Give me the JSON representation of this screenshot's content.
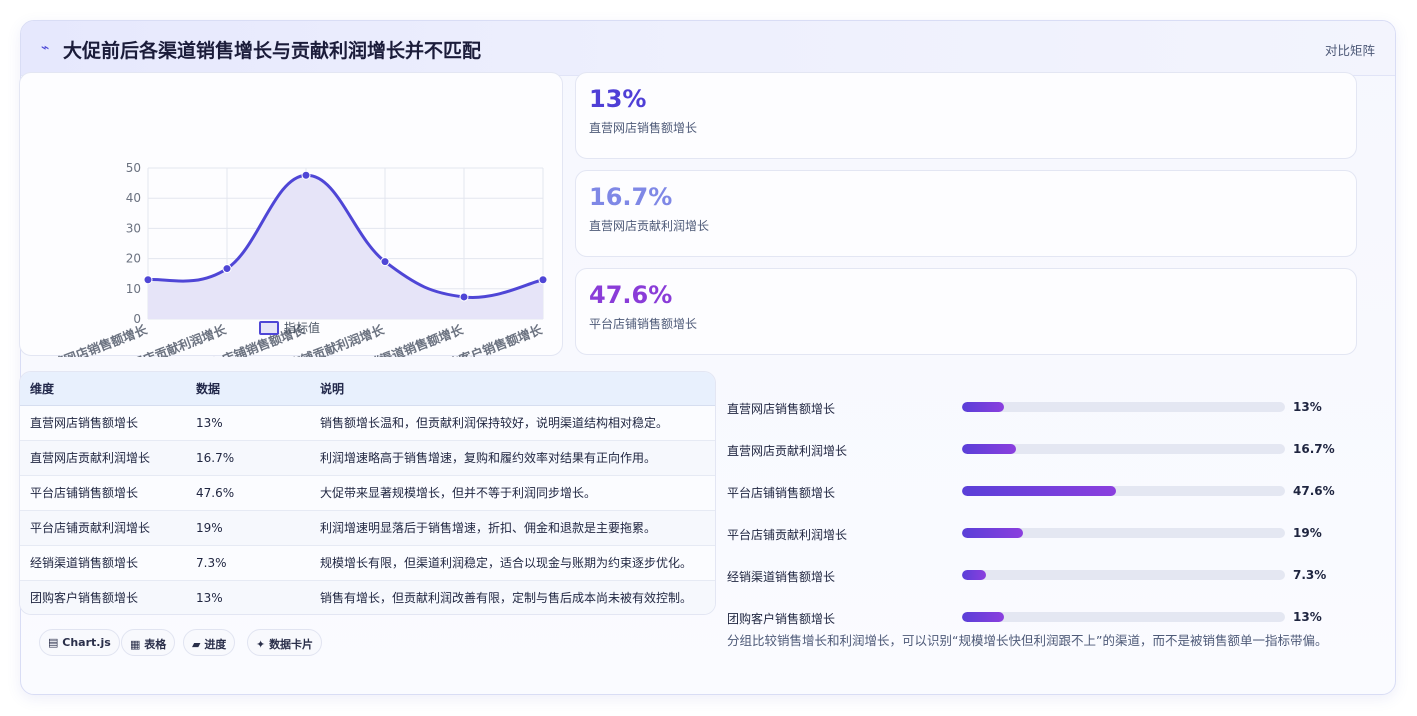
{
  "header": {
    "icon": "trend-icon",
    "title": "大促前后各渠道销售增长与贡献利润增长并不匹配",
    "badge": "对比矩阵"
  },
  "chart_data": {
    "type": "line",
    "categories": [
      "直营网店销售额增长",
      "直营网店贡献利润增长",
      "平台店铺销售额增长",
      "平台店铺贡献利润增长",
      "经销渠道销售额增长",
      "团购客户销售额增长"
    ],
    "series": [
      {
        "name": "指标值",
        "values": [
          13,
          16.7,
          47.6,
          19,
          7.3,
          13
        ]
      }
    ],
    "ylim": [
      0,
      50
    ],
    "yticks": [
      0,
      10,
      20,
      30,
      40,
      50
    ],
    "grid": true,
    "legend": "bottom",
    "smooth": true,
    "filled": true,
    "colors": {
      "line": "#4f46d6",
      "fill": "#e6e4f8"
    }
  },
  "kpis": [
    {
      "value": "13%",
      "label": "直营网店销售额增长",
      "color": "#4f3fd6"
    },
    {
      "value": "16.7%",
      "label": "直营网店贡献利润增长",
      "color": "#7f88e6"
    },
    {
      "value": "47.6%",
      "label": "平台店铺销售额增长",
      "color": "#8a3cd8"
    }
  ],
  "table": {
    "headers": [
      "维度",
      "数据",
      "说明"
    ],
    "rows": [
      [
        "直营网店销售额增长",
        "13%",
        "销售额增长温和，但贡献利润保持较好，说明渠道结构相对稳定。"
      ],
      [
        "直营网店贡献利润增长",
        "16.7%",
        "利润增速略高于销售增速，复购和履约效率对结果有正向作用。"
      ],
      [
        "平台店铺销售额增长",
        "47.6%",
        "大促带来显著规模增长，但并不等于利润同步增长。"
      ],
      [
        "平台店铺贡献利润增长",
        "19%",
        "利润增速明显落后于销售增速，折扣、佣金和退款是主要拖累。"
      ],
      [
        "经销渠道销售额增长",
        "7.3%",
        "规模增长有限，但渠道利润稳定，适合以现金与账期为约束逐步优化。"
      ],
      [
        "团购客户销售额增长",
        "13%",
        "销售有增长，但贡献利润改善有限，定制与售后成本尚未被有效控制。"
      ]
    ]
  },
  "chips": [
    {
      "icon": "▤",
      "label": "Chart.js"
    },
    {
      "icon": "▦",
      "label": "表格"
    },
    {
      "icon": "▰",
      "label": "进度"
    },
    {
      "icon": "✦",
      "label": "数据卡片"
    }
  ],
  "progress": [
    {
      "label": "直营网店销售额增长",
      "value": "13%",
      "percent": 13
    },
    {
      "label": "直营网店贡献利润增长",
      "value": "16.7%",
      "percent": 16.7
    },
    {
      "label": "平台店铺销售额增长",
      "value": "47.6%",
      "percent": 47.6
    },
    {
      "label": "平台店铺贡献利润增长",
      "value": "19%",
      "percent": 19
    },
    {
      "label": "经销渠道销售额增长",
      "value": "7.3%",
      "percent": 7.3
    },
    {
      "label": "团购客户销售额增长",
      "value": "13%",
      "percent": 13
    }
  ],
  "progress_max": 100,
  "footnote": "分组比较销售增长和利润增长，可以识别“规模增长快但利润跟不上”的渠道，而不是被销售额单一指标带偏。"
}
